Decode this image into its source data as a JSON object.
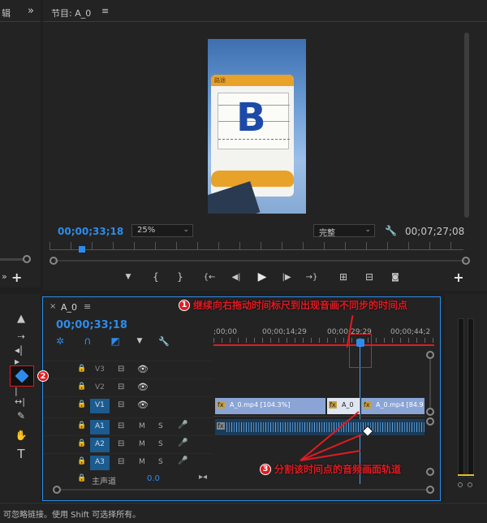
{
  "left_panel": {
    "tab_fragment": "辑",
    "more": "»"
  },
  "program_monitor": {
    "title": "节目: A_0",
    "menu": "≡",
    "timecode_current": "00;00;33;18",
    "zoom": "25%",
    "quality": "完整",
    "timecode_duration": "00;07;27;08",
    "card_letter": "B",
    "card_brand": "路途"
  },
  "transport": {
    "marker": "▼",
    "in": "{",
    "out": "}",
    "goto_in": "{←",
    "step_back": "◀|",
    "play": "▶",
    "step_fwd": "|▶",
    "goto_out": "→}",
    "lift": "⊞",
    "extract": "⊟",
    "export": "📷",
    "add": "+"
  },
  "tools": {
    "type_tool": "T"
  },
  "timeline": {
    "close": "×",
    "name": "A_0",
    "menu": "≡",
    "timecode": "00;00;33;18",
    "ruler_labels": [
      ";00;00",
      "00;00;14;29",
      "00;00;29;29",
      "00;00;44;2"
    ],
    "tracks": [
      {
        "id": "V3",
        "type": "video"
      },
      {
        "id": "V2",
        "type": "video"
      },
      {
        "id": "V1",
        "type": "video",
        "active": true
      },
      {
        "id": "A1",
        "type": "audio",
        "active": true
      },
      {
        "id": "A2",
        "type": "audio",
        "active": true
      },
      {
        "id": "A3",
        "type": "audio",
        "active": true
      }
    ],
    "audio_letters": {
      "mute": "M",
      "solo": "S"
    },
    "master_label": "主声道",
    "master_value": "0.0",
    "clips": [
      {
        "label": "A_0.mp4 [104.3%]"
      },
      {
        "label": "A_0"
      },
      {
        "label": "A_0.mp4 [84.9"
      }
    ],
    "fx": "fx"
  },
  "annotations": [
    {
      "num": "1",
      "text": "继续向右拖动时间标尺到出现音画不同步的时间点"
    },
    {
      "num": "2",
      "text": ""
    },
    {
      "num": "3",
      "text": "分割该时间点的音频画面轨道"
    }
  ],
  "status_bar": {
    "text": "可忽略链接。使用 Shift 可选择所有。"
  },
  "colors": {
    "accent": "#2d8ceb",
    "annotation": "#e11b22",
    "video_clip": "#8aa4d6",
    "audio_clip": "#1a3c5a"
  }
}
